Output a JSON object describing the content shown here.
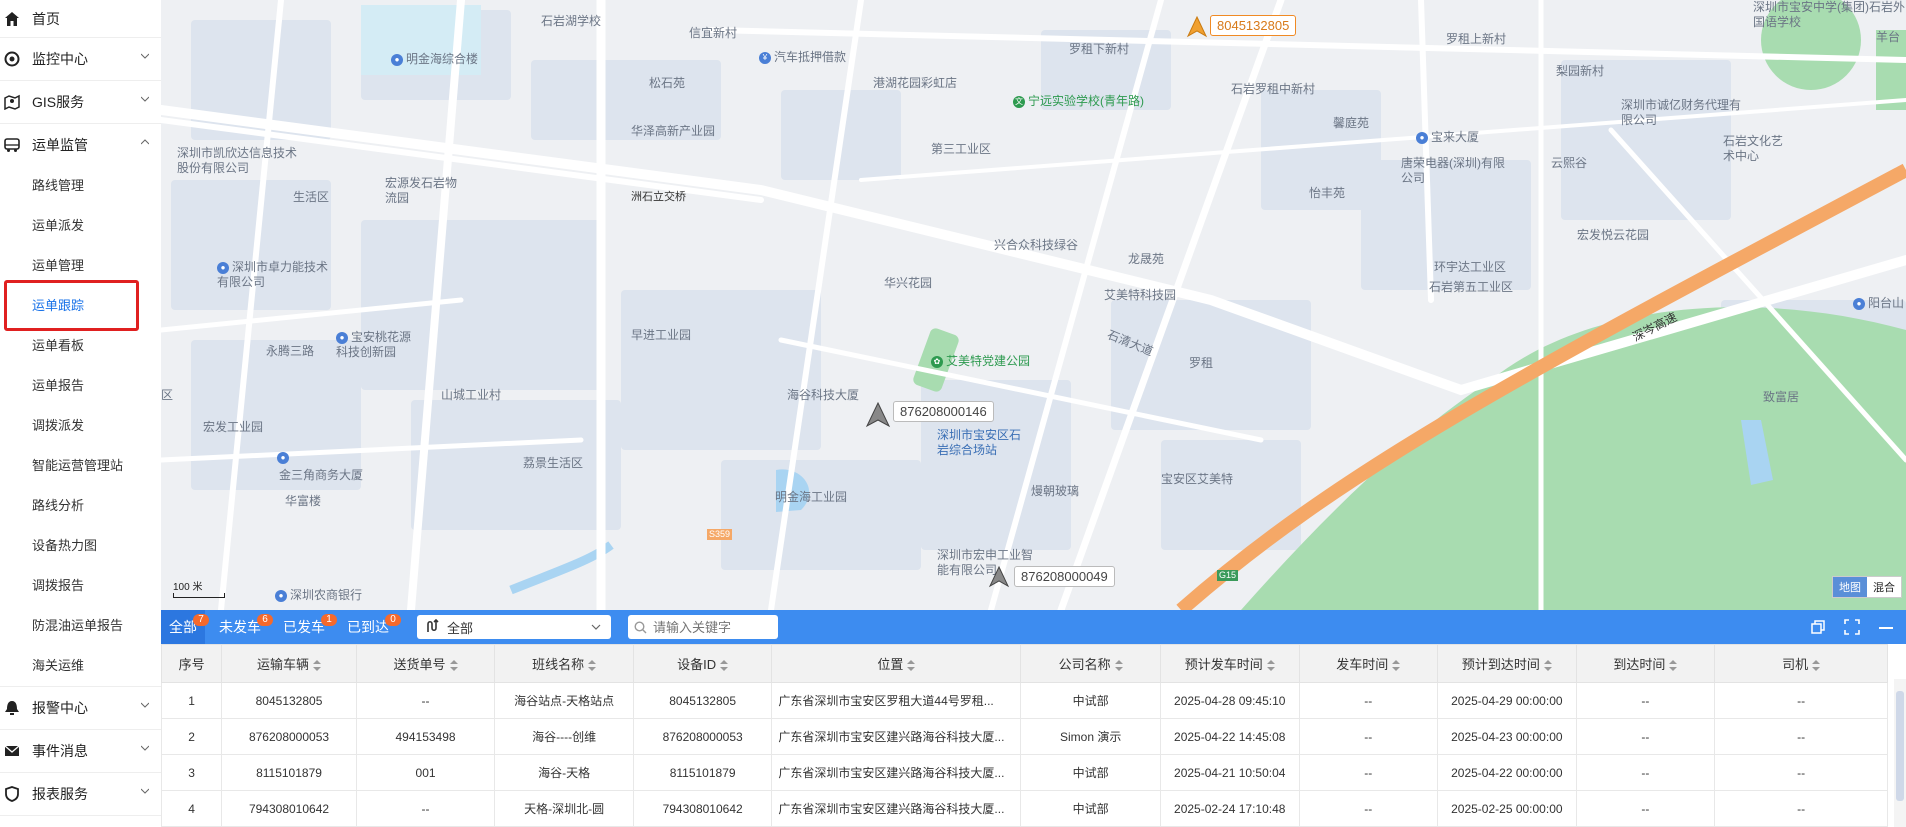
{
  "sidebar": {
    "items": [
      {
        "label": "首页",
        "icon": "home-icon",
        "expandable": false
      },
      {
        "label": "监控中心",
        "icon": "monitor-icon",
        "expandable": true
      },
      {
        "label": "GIS服务",
        "icon": "map-icon",
        "expandable": true
      },
      {
        "label": "运单监管",
        "icon": "truck-icon",
        "expandable": true,
        "expanded": true
      }
    ],
    "sub_items": [
      "路线管理",
      "运单派发",
      "运单管理",
      "运单跟踪",
      "运单看板",
      "运单报告",
      "调拨派发",
      "智能运营管理站",
      "路线分析",
      "设备热力图",
      "调拨报告",
      "防混油运单报告",
      "海关运维"
    ],
    "active_sub": "运单跟踪",
    "bottom_items": [
      {
        "label": "报警中心",
        "icon": "alarm-icon"
      },
      {
        "label": "事件消息",
        "icon": "mail-icon"
      },
      {
        "label": "报表服务",
        "icon": "shield-icon"
      }
    ]
  },
  "map": {
    "labels": [
      "石岩湖学校",
      "信宜新村",
      "罗租下新村",
      "8045132805",
      "罗租上新村",
      "深圳市宝安中学(集团)石岩外国语学校",
      "羊台",
      "明金海综合楼",
      "汽车抵押借款",
      "松石苑",
      "港湖花园彩虹店",
      "宁远实验学校(青年路)",
      "石岩罗租中新村",
      "馨庭苑",
      "梨园新村",
      "深圳市诚亿财务代理有限公司",
      "华泽高新产业园",
      "深圳市凯欣达信息技术股份有限公司",
      "宏源发石岩物流园",
      "第三工业区",
      "宝来大厦",
      "唐荣电器(深圳)有限公司",
      "云熙谷",
      "石岩文化艺术中心",
      "生活区",
      "洲石立交桥",
      "怡丰苑",
      "宏发悦云花园",
      "深圳市卓力能技术有限公司",
      "兴合众科技绿谷",
      "龙晟苑",
      "环宇达工业区",
      "石岩第五工业区",
      "华兴花园",
      "艾美特科技园",
      "阳台山",
      "永腾三路",
      "宝安桃花源科技创新园",
      "早进工业园",
      "石清大道",
      "罗租",
      "深岑高速",
      "艾美特党建公园",
      "致富居",
      "海谷科技大厦",
      "876208000146",
      "山城工业村",
      "宏发工业园",
      "深圳市宝安区石岩综合场站",
      "金三角商务大厦",
      "荔景生活区",
      "明金海工业园",
      "熳朝玻璃",
      "宝安区艾美特",
      "华富楼",
      "深圳市宏申工业智能有限公司",
      "876208000049",
      "深圳农商银行",
      "S359",
      "G15",
      "100 米",
      "区",
      "华富楼"
    ],
    "vehicles": [
      {
        "id": "8045132805",
        "status": "moving"
      },
      {
        "id": "876208000146",
        "status": "stopped"
      },
      {
        "id": "876208000049",
        "status": "stopped"
      }
    ],
    "scale": "100 米",
    "switch": {
      "map": "地图",
      "hybrid": "混合",
      "selected": "地图"
    }
  },
  "panel": {
    "tabs": [
      {
        "label": "全部",
        "count": "7",
        "selected": true
      },
      {
        "label": "未发车",
        "count": "6"
      },
      {
        "label": "已发车",
        "count": "1"
      },
      {
        "label": "已到达",
        "count": "0"
      }
    ],
    "route_select": "全部",
    "search_placeholder": "请输入关键字",
    "columns": [
      "序号",
      "运输车辆",
      "送货单号",
      "班线名称",
      "设备ID",
      "位置",
      "公司名称",
      "预计发车时间",
      "发车时间",
      "预计到达时间",
      "到达时间",
      "司机"
    ],
    "rows": [
      [
        "1",
        "8045132805",
        "--",
        "海谷站点-天格站点",
        "8045132805",
        "广东省深圳市宝安区罗租大道44号罗租...",
        "中试部",
        "2025-04-28 09:45:10",
        "--",
        "2025-04-29 00:00:00",
        "--",
        "--"
      ],
      [
        "2",
        "876208000053",
        "494153498",
        "海谷----创维",
        "876208000053",
        "广东省深圳市宝安区建兴路海谷科技大厦...",
        "Simon 演示",
        "2025-04-22 14:45:08",
        "--",
        "2025-04-23 00:00:00",
        "--",
        "--"
      ],
      [
        "3",
        "8115101879",
        "001",
        "海谷-天格",
        "8115101879",
        "广东省深圳市宝安区建兴路海谷科技大厦...",
        "中试部",
        "2025-04-21 10:50:04",
        "--",
        "2025-04-22 00:00:00",
        "--",
        "--"
      ],
      [
        "4",
        "794308010642",
        "--",
        "天格-深圳北-圆",
        "794308010642",
        "广东省深圳市宝安区建兴路海谷科技大厦...",
        "中试部",
        "2025-02-24 17:10:48",
        "--",
        "2025-02-25 00:00:00",
        "--",
        "--"
      ]
    ]
  },
  "colors": {
    "accent": "#3d8cf0",
    "badge": "#f5692c",
    "highway": "#f5a867",
    "park": "#a8dcb0",
    "active_box": "#e02020"
  }
}
